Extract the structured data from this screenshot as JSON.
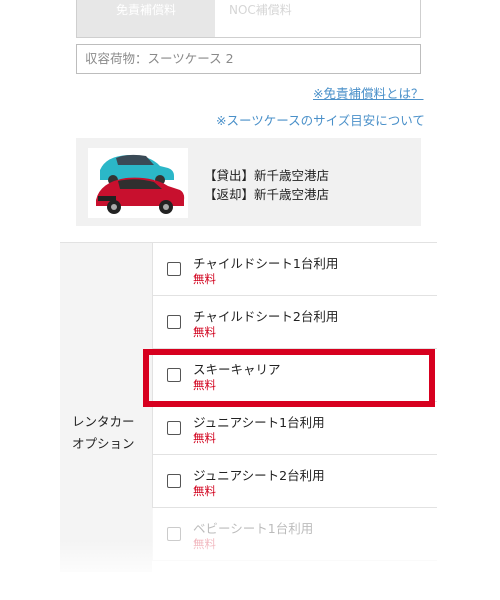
{
  "top_tabs": {
    "active_label": "免責補償料",
    "inactive_label": "NOC補償料"
  },
  "cargo": {
    "text": "収容荷物：スーツケース 2"
  },
  "links": {
    "insurance": "※免責補償料とは？",
    "suitcase_size": "※スーツケースのサイズ目安について"
  },
  "store": {
    "pickup": "【貸出】新千歳空港店",
    "return": "【返却】新千歳空港店"
  },
  "options": {
    "section_label_line1": "レンタカー",
    "section_label_line2": "オプション",
    "items": [
      {
        "name": "チャイルドシート1台利用",
        "price": "無料"
      },
      {
        "name": "チャイルドシート2台利用",
        "price": "無料"
      },
      {
        "name": "スキーキャリア",
        "price": "無料"
      },
      {
        "name": "ジュニアシート1台利用",
        "price": "無料"
      },
      {
        "name": "ジュニアシート2台利用",
        "price": "無料"
      },
      {
        "name": "ベビーシート1台利用",
        "price": "無料"
      }
    ]
  },
  "colors": {
    "highlight": "#d7001f",
    "price": "#d1001c",
    "link": "#4a90c9"
  }
}
